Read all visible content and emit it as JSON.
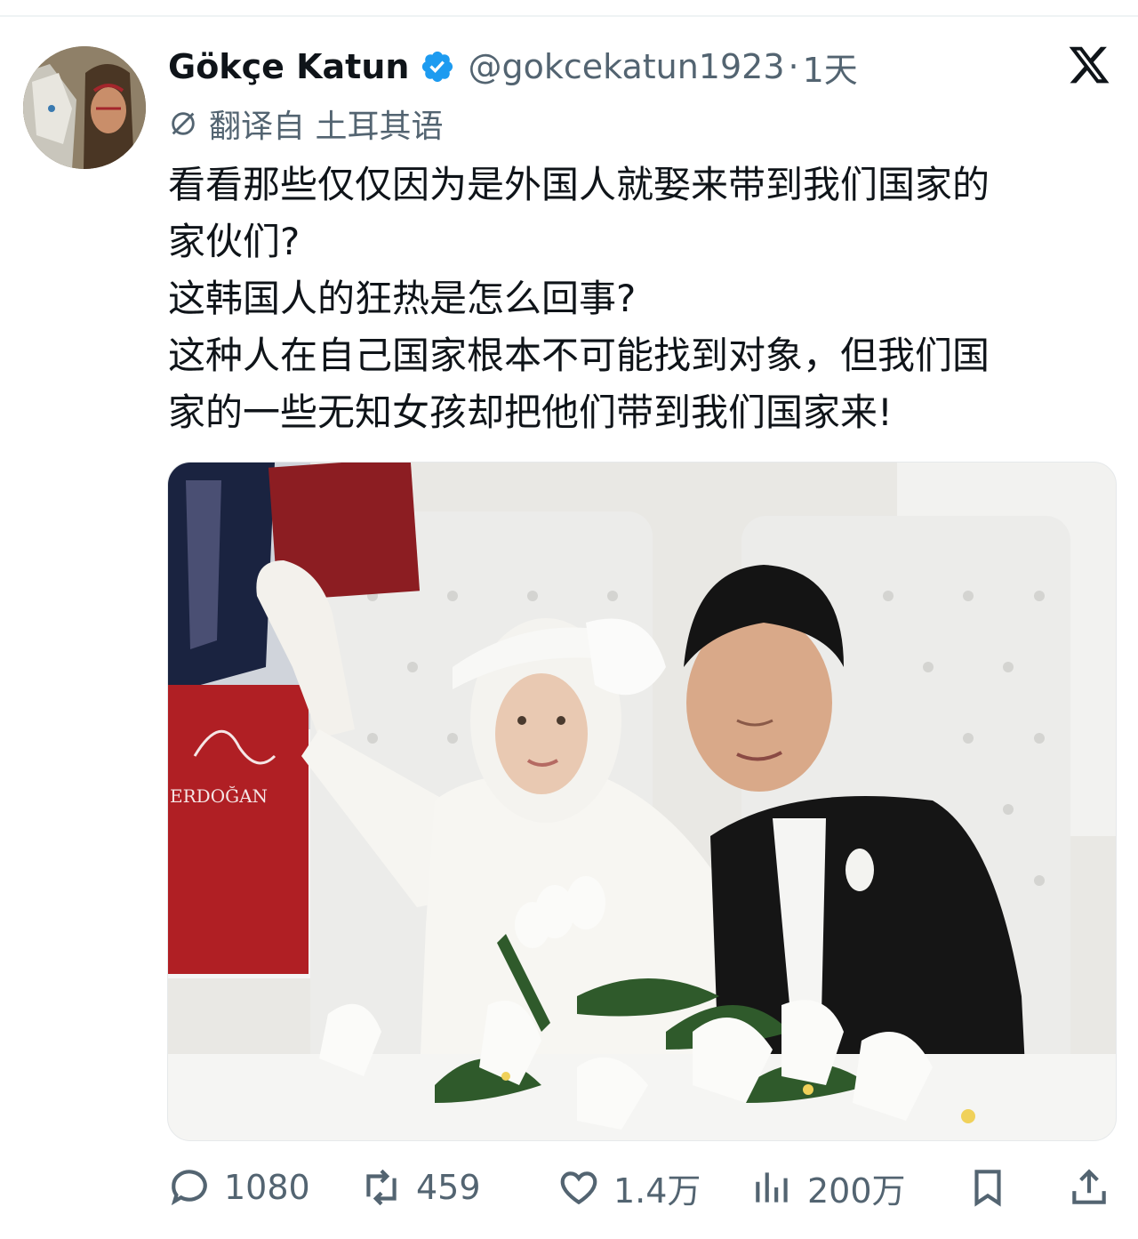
{
  "tweet": {
    "author": {
      "display_name": "Gökçe Katun",
      "handle": "@gokcekatun1923",
      "verified": true,
      "verified_color": "#1d9bf0"
    },
    "separator": "·",
    "time": "1天",
    "translated_label": "翻译自 土耳其语",
    "text": "看看那些仅仅因为是外国人就娶来带到我们国家的\n家伙们?\n这韩国人的狂热是怎么回事?\n这种人在自己国家根本不可能找到对象，但我们国\n家的一些无知女孩却把他们带到我们国家来!",
    "media": {
      "poster_signature": "ERDOĞAN"
    },
    "actions": {
      "replies": "1080",
      "retweets": "459",
      "likes": "1.4万",
      "views": "200万"
    }
  },
  "icons": {
    "platform": "x-logo-icon",
    "translate": "translate-icon",
    "reply": "reply-icon",
    "retweet": "retweet-icon",
    "like": "heart-icon",
    "views": "views-icon",
    "bookmark": "bookmark-icon",
    "share": "share-icon"
  },
  "colors": {
    "text_primary": "#0f1419",
    "text_secondary": "#536471",
    "accent": "#1d9bf0"
  }
}
